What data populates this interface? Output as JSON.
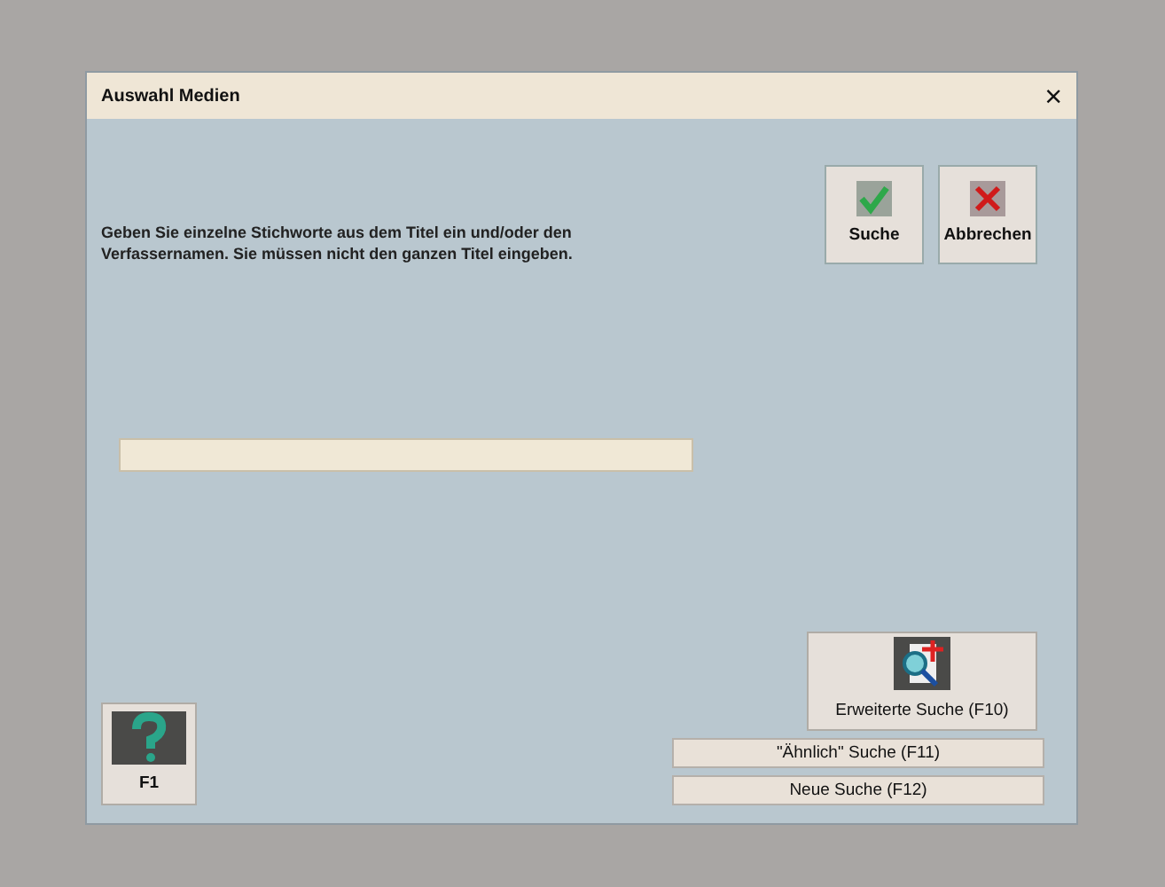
{
  "window": {
    "title": "Auswahl Medien",
    "close": "×"
  },
  "instruction": "Geben Sie einzelne Stichworte aus dem Titel ein und/oder den Verfassernamen. Sie müssen nicht den ganzen Titel eingeben.",
  "top_buttons": [
    {
      "kind": "ok",
      "label": "Suche"
    },
    {
      "kind": "cancel",
      "label": "Abbrechen"
    }
  ],
  "help_button": {
    "label": "F1"
  },
  "advanced_button": {
    "label": "Erweiterte Suche (F10)"
  },
  "text_buttons": [
    {
      "label": "\"Ähnlich\" Suche (F11)"
    },
    {
      "label": "Neue Suche (F12)"
    }
  ]
}
